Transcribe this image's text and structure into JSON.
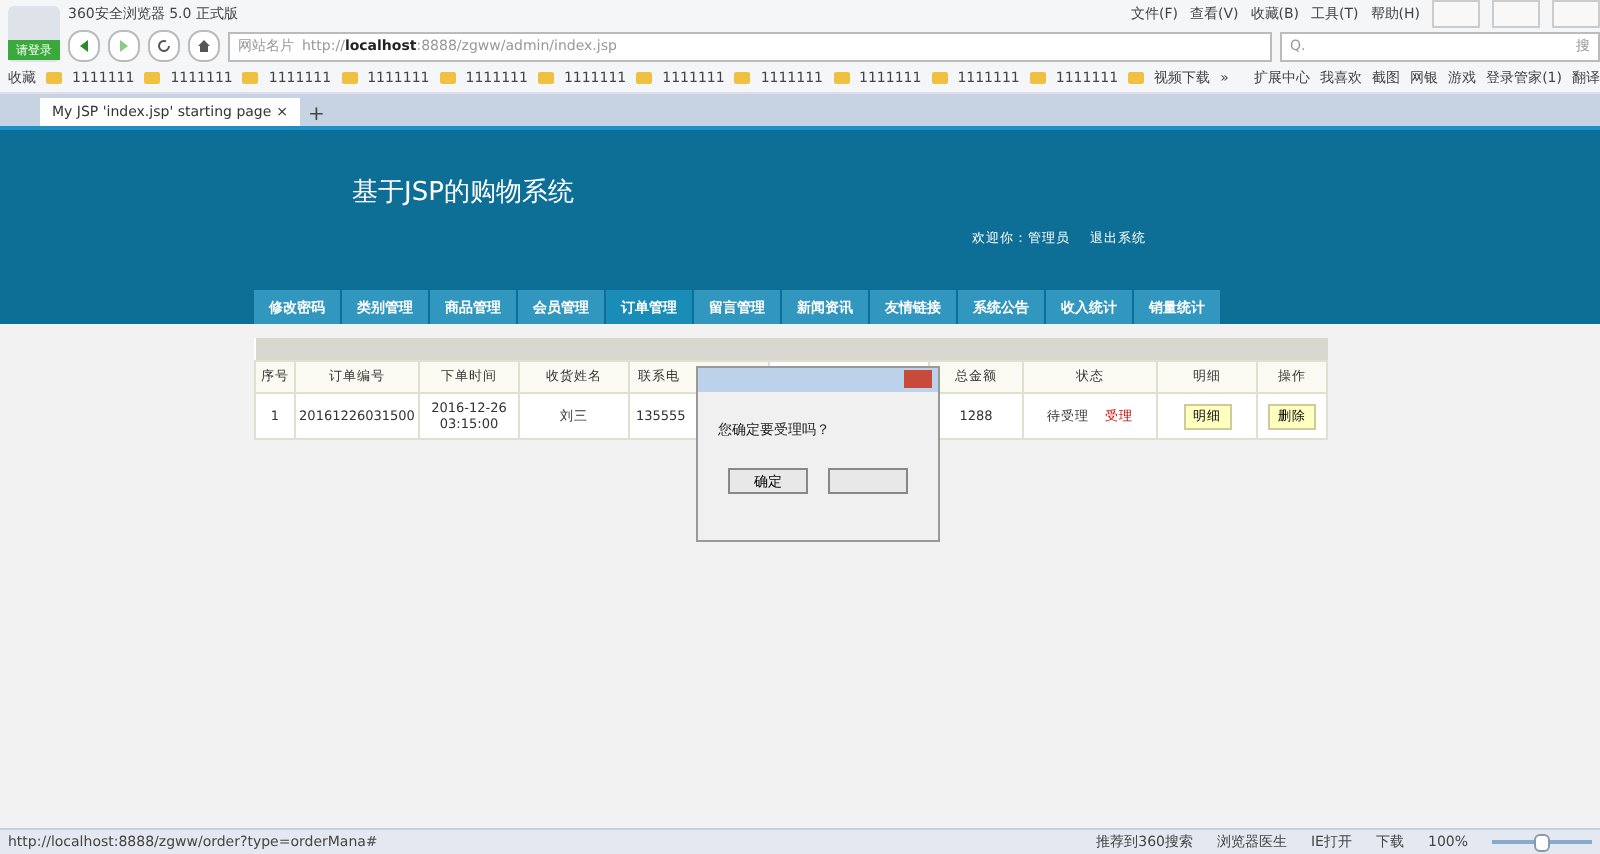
{
  "browser": {
    "title": "360安全浏览器 5.0 正式版",
    "login": "请登录",
    "menu": [
      "文件(F)",
      "查看(V)",
      "收藏(B)",
      "工具(T)",
      "帮助(H)"
    ],
    "site_name": "网站名片",
    "url_prefix": "http://",
    "url_host": "localhost",
    "url_rest": ":8888/zgww/admin/index.jsp",
    "search_placeholder": "Q.",
    "search_button": "搜",
    "bookmarks_label": "收藏",
    "bookmarks": [
      "1111111",
      "1111111",
      "1111111",
      "1111111",
      "1111111",
      "1111111",
      "1111111",
      "1111111",
      "1111111",
      "1111111",
      "1111111",
      "视频下载"
    ],
    "more": "»",
    "tools": [
      "扩展中心",
      "我喜欢",
      "截图",
      "网银",
      "游戏",
      "登录管家(1)",
      "翻译"
    ],
    "tabs": [
      {
        "label": "My JSP 'index.jsp' starting page",
        "selected": true
      }
    ],
    "close": "×",
    "new_tab": "+"
  },
  "page": {
    "site_title": "基于JSP的购物系统",
    "welcome": "欢迎你：管理员",
    "logout": "退出系统",
    "nav": [
      {
        "label": "修改密码",
        "selected": false
      },
      {
        "label": "类别管理",
        "selected": false
      },
      {
        "label": "商品管理",
        "selected": false
      },
      {
        "label": "会员管理",
        "selected": false
      },
      {
        "label": "订单管理",
        "selected": true
      },
      {
        "label": "留言管理",
        "selected": false
      },
      {
        "label": "新闻资讯",
        "selected": false
      },
      {
        "label": "友情链接",
        "selected": false
      },
      {
        "label": "系统公告",
        "selected": false
      },
      {
        "label": "收入统计",
        "selected": false
      },
      {
        "label": "销量统计",
        "selected": false
      }
    ],
    "table": {
      "columns": [
        "序号",
        "订单编号",
        "下单时间",
        "收货姓名",
        "联系电",
        "总金额",
        "状态",
        "明细",
        "操作"
      ],
      "rows": [
        {
          "index": "1",
          "order_no": "20161226031500",
          "time": "2016-12-26 03:15:00",
          "name": "刘三",
          "phone": "135555",
          "total": "1288",
          "status": "待受理",
          "accept": "受理",
          "detail": "明细",
          "delete": "删除"
        }
      ]
    }
  },
  "dialog": {
    "message": "您确定要受理吗？",
    "ok": "确定"
  },
  "status_bar": {
    "url": "http://localhost:8888/zgww/order?type=orderMana#",
    "items": [
      "推荐到360搜索",
      "浏览器医生",
      "IE打开",
      "下载"
    ],
    "zoom": "100%",
    "zoom_slider": {
      "level": 0.5
    }
  }
}
